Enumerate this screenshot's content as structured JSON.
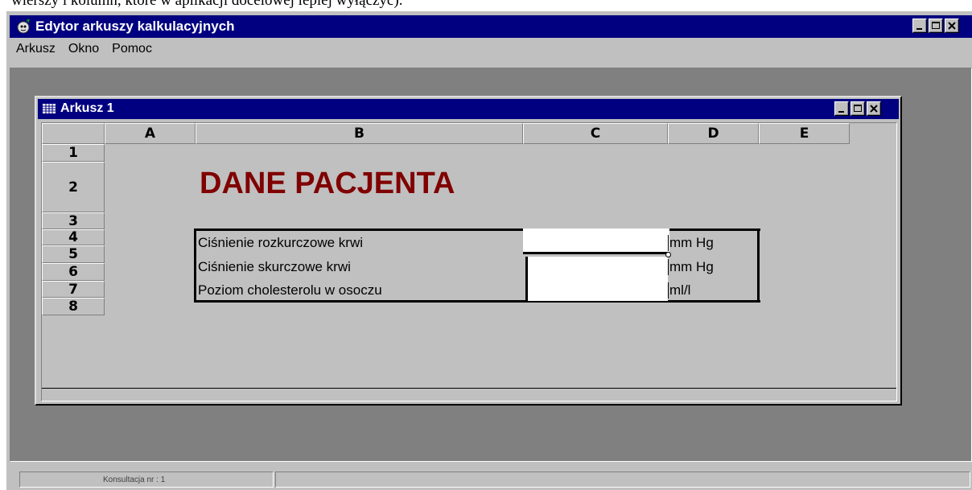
{
  "top_fragment": "wierszy i kolumn, które w aplikacji docelowej lepiej wyłączyć).",
  "app": {
    "title": "Edytor arkuszy kalkulacyjnych"
  },
  "menu": {
    "items": [
      "Arkusz",
      "Okno",
      "Pomoc"
    ]
  },
  "child_window": {
    "title": "Arkusz 1"
  },
  "sheet": {
    "columns": [
      "A",
      "B",
      "C",
      "D",
      "E"
    ],
    "rows": [
      "1",
      "2",
      "3",
      "4",
      "5",
      "6",
      "7",
      "8"
    ],
    "heading": "DANE PACJENTA",
    "heading_color": "#800000",
    "fields": [
      {
        "label": "Ciśnienie rozkurczowe krwi",
        "value": "",
        "unit": "mm Hg"
      },
      {
        "label": "Ciśnienie skurczowe krwi",
        "value": "",
        "unit": "mm Hg"
      },
      {
        "label": "Poziom cholesterolu w osoczu",
        "value": "",
        "unit": "ml/l"
      }
    ]
  },
  "status": {
    "consult_label": "Konsultacja nr : 1"
  },
  "colors": {
    "titlebar": "#000080",
    "face": "#c0c0c0",
    "workspace": "#808080"
  }
}
